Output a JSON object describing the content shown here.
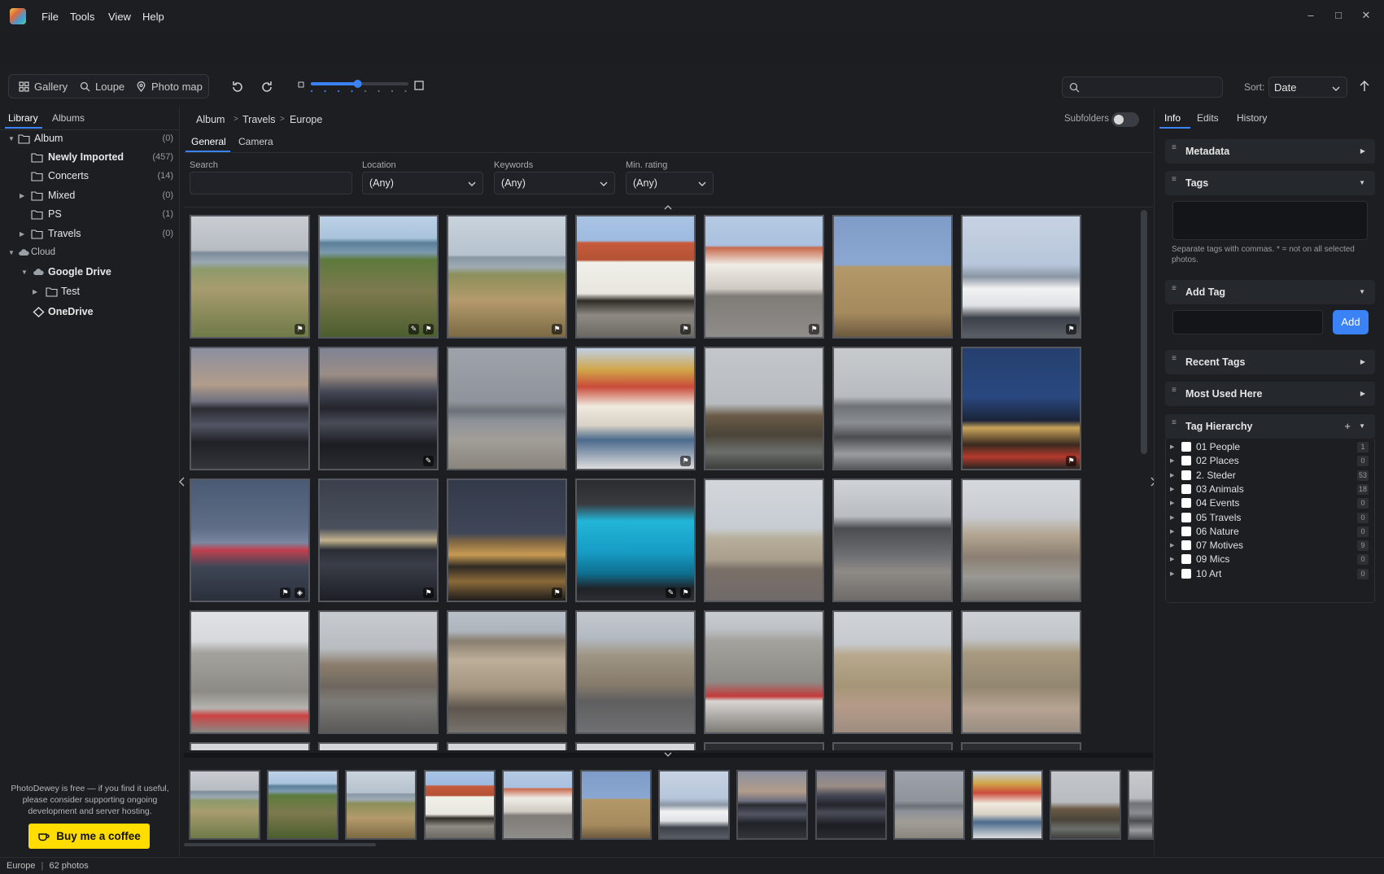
{
  "menu": {
    "file": "File",
    "tools": "Tools",
    "view": "View",
    "help": "Help"
  },
  "toolbar": {
    "views": [
      "Gallery",
      "Loupe",
      "Photo map"
    ],
    "zoom_level": 0.48,
    "search_placeholder": "",
    "sort_label": "Sort:",
    "sort_value": "Date"
  },
  "left": {
    "tabs": [
      "Library",
      "Albums"
    ],
    "tree": [
      {
        "label": "Album",
        "count": "(0)",
        "kind": "folder",
        "expanded": true
      },
      {
        "label": "Newly Imported",
        "count": "(457)",
        "kind": "folder"
      },
      {
        "label": "Concerts",
        "count": "(14)",
        "kind": "folder"
      },
      {
        "label": "Mixed",
        "count": "(0)",
        "kind": "folder",
        "collapsed": true
      },
      {
        "label": "PS",
        "count": "(1)",
        "kind": "folder"
      },
      {
        "label": "Travels",
        "count": "(0)",
        "kind": "folder",
        "collapsed": true
      },
      {
        "label": "Cloud",
        "count": "",
        "kind": "cloud",
        "expanded": true
      },
      {
        "label": "Google Drive",
        "count": "",
        "kind": "cloud",
        "expanded": true
      },
      {
        "label": "Test",
        "count": "",
        "kind": "folder",
        "collapsed": true
      },
      {
        "label": "OneDrive",
        "count": "",
        "kind": "diamond"
      }
    ],
    "support_text": "PhotoDewey is free — if you find it useful, please consider supporting ongoing development and server hosting.",
    "coffee_label": "Buy me a coffee"
  },
  "center": {
    "breadcrumb": [
      "Album",
      "Travels",
      "Europe"
    ],
    "subfolders_label": "Subfolders",
    "subtabs": [
      "General",
      "Camera"
    ],
    "filters": {
      "search_label": "Search",
      "search_value": "",
      "location_label": "Location",
      "location_value": "(Any)",
      "keywords_label": "Keywords",
      "keywords_value": "(Any)",
      "rating_label": "Min. rating",
      "rating_value": "(Any)"
    },
    "thumbnails": [
      {
        "scene": "coast",
        "badges": [
          "pin"
        ]
      },
      {
        "scene": "coast-green",
        "badges": [
          "edit",
          "pin"
        ]
      },
      {
        "scene": "coast-dry",
        "badges": [
          "pin"
        ]
      },
      {
        "scene": "white-house",
        "badges": [
          "pin"
        ]
      },
      {
        "scene": "street",
        "badges": [
          "pin"
        ]
      },
      {
        "scene": "tower-building",
        "badges": []
      },
      {
        "scene": "harbor-boats",
        "badges": [
          "pin"
        ]
      },
      {
        "scene": "dusk-rocks",
        "badges": []
      },
      {
        "scene": "dusk-rocks2",
        "badges": [
          "edit"
        ]
      },
      {
        "scene": "harbor-grey",
        "badges": []
      },
      {
        "scene": "colorful-town",
        "badges": [
          "pin"
        ]
      },
      {
        "scene": "chimney-rocks",
        "badges": []
      },
      {
        "scene": "sea-waves",
        "badges": []
      },
      {
        "scene": "bigben-night",
        "badges": [
          "pin"
        ]
      },
      {
        "scene": "london-eye",
        "badges": [
          "pin",
          "tag"
        ]
      },
      {
        "scene": "city-night",
        "badges": [
          "pin"
        ]
      },
      {
        "scene": "parliament-night",
        "badges": [
          "pin"
        ]
      },
      {
        "scene": "blue-columns",
        "badges": [
          "edit",
          "pin"
        ]
      },
      {
        "scene": "hall-of-memory",
        "badges": []
      },
      {
        "scene": "modern-street",
        "badges": []
      },
      {
        "scene": "clock-tower",
        "badges": []
      },
      {
        "scene": "town-hall",
        "badges": []
      },
      {
        "scene": "victoria-square",
        "badges": []
      },
      {
        "scene": "ornate-building",
        "badges": []
      },
      {
        "scene": "ornate-building2",
        "badges": []
      },
      {
        "scene": "museum-front",
        "badges": []
      },
      {
        "scene": "council-house",
        "badges": []
      },
      {
        "scene": "council-house2",
        "badges": []
      }
    ],
    "strip_count": 13
  },
  "right": {
    "tabs": [
      "Info",
      "Edits",
      "History"
    ],
    "sections": {
      "metadata": "Metadata",
      "tags": "Tags",
      "tags_help": "Separate tags with commas. * = not on all selected photos.",
      "add_tag": "Add Tag",
      "add_button": "Add",
      "recent_tags": "Recent Tags",
      "most_used": "Most Used Here",
      "hierarchy": "Tag Hierarchy",
      "hierarchy_add": "+"
    },
    "tag_hierarchy": [
      {
        "name": "01 People",
        "count": "1"
      },
      {
        "name": "02 Places",
        "count": "0"
      },
      {
        "name": "2. Steder",
        "count": "53"
      },
      {
        "name": "03 Animals",
        "count": "18"
      },
      {
        "name": "04 Events",
        "count": "0"
      },
      {
        "name": "05 Travels",
        "count": "0"
      },
      {
        "name": "06 Nature",
        "count": "0"
      },
      {
        "name": "07 Motives",
        "count": "9"
      },
      {
        "name": "09 Mics",
        "count": "0"
      },
      {
        "name": "10 Art",
        "count": "0"
      }
    ]
  },
  "status": {
    "folder": "Europe",
    "separator": "|",
    "count": "62 photos"
  },
  "colors": {
    "accent": "#3b82f6",
    "coffee": "#ffdd00",
    "background": "#1c1e22"
  }
}
